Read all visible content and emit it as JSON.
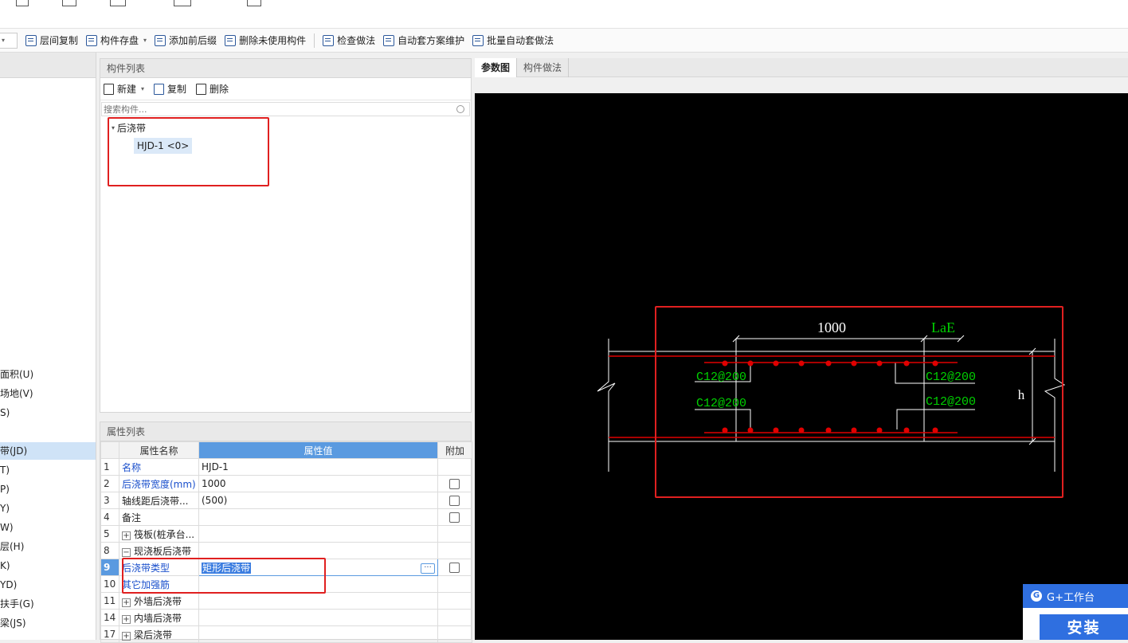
{
  "toolbar": {
    "layer_copy": "层间复制",
    "component_store": "构件存盘",
    "add_prefix_suffix": "添加前后缀",
    "delete_unused": "删除未使用构件",
    "check_method": "检查做法",
    "auto_scheme": "自动套方案维护",
    "batch_auto": "批量自动套做法"
  },
  "left_nav": {
    "items": [
      "面积(U)",
      "场地(V)",
      "S)",
      "带(JD)",
      "T)",
      "P)",
      "Y)",
      "W)",
      "层(H)",
      "K)",
      "YD)",
      "扶手(G)",
      "梁(JS)"
    ]
  },
  "component_list": {
    "title": "构件列表",
    "new_label": "新建",
    "copy_label": "复制",
    "delete_label": "删除",
    "search_placeholder": "搜索构件...",
    "tree_root": "后浇带",
    "tree_child": "HJD-1 <0>"
  },
  "property_list": {
    "title": "属性列表",
    "headers": {
      "name": "属性名称",
      "value": "属性值",
      "extra": "附加"
    },
    "rows": [
      {
        "num": "1",
        "name": "名称",
        "value": "HJD-1"
      },
      {
        "num": "2",
        "name": "后浇带宽度(mm)",
        "value": "1000"
      },
      {
        "num": "3",
        "name": "轴线距后浇带...",
        "value": "(500)"
      },
      {
        "num": "4",
        "name": "备注",
        "value": ""
      },
      {
        "num": "5",
        "name": "筏板(桩承台...",
        "value": ""
      },
      {
        "num": "8",
        "name": "现浇板后浇带",
        "value": ""
      },
      {
        "num": "9",
        "name": "后浇带类型",
        "value": "矩形后浇带"
      },
      {
        "num": "10",
        "name": "其它加强筋",
        "value": ""
      },
      {
        "num": "11",
        "name": "外墙后浇带",
        "value": ""
      },
      {
        "num": "14",
        "name": "内墙后浇带",
        "value": ""
      },
      {
        "num": "17",
        "name": "梁后浇带",
        "value": ""
      }
    ]
  },
  "view_tabs": {
    "param_diagram": "参数图",
    "component_method": "构件做法"
  },
  "drawing": {
    "width_label": "1000",
    "lae_label": "LaE",
    "rebar_top_left": "C12@200",
    "rebar_bottom_left": "C12@200",
    "rebar_top_right": "C12@200",
    "rebar_bottom_right": "C12@200",
    "height_label": "h"
  },
  "widget": {
    "title": "G+工作台",
    "install": "安装",
    "logo": "G"
  },
  "colors": {
    "accent": "#5a9ae0",
    "highlight_box": "#e02020",
    "cad_green": "#00d000",
    "cad_red": "#e00000"
  }
}
